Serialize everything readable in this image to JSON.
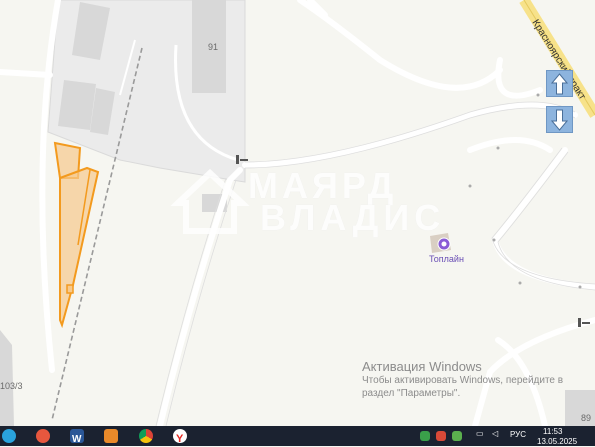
{
  "map": {
    "building_labels": {
      "b91": "91",
      "b103": "103/3",
      "b89": "89"
    },
    "road_label": "Красноярский тракт",
    "poi": {
      "name": "Топлайн",
      "icon": "gas-station-icon"
    },
    "watermark": {
      "line1": "МАЯРД",
      "line2": "ВЛАДИС"
    },
    "parcel_color": "#f39a1e"
  },
  "controls": {
    "up_icon": "arrow-up-icon",
    "down_icon": "arrow-down-icon"
  },
  "activation": {
    "title": "Активация Windows",
    "line1": "Чтобы активировать Windows, перейдите в",
    "line2": "раздел \"Параметры\"."
  },
  "taskbar": {
    "apps": [
      "telegram-icon",
      "browser-icon",
      "word-icon",
      "app-icon",
      "chrome-icon",
      "yandex-icon"
    ],
    "language": "РУС",
    "time": "11:53",
    "date": "13.05.2025"
  }
}
